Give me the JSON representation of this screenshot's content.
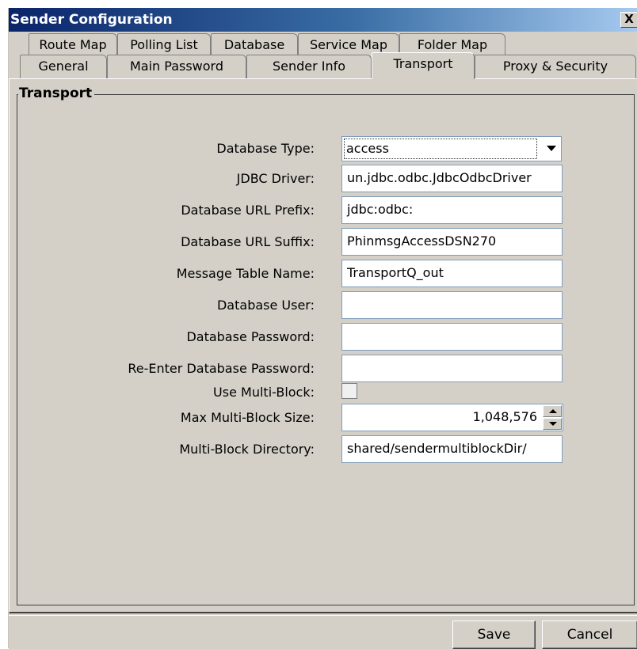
{
  "window": {
    "title": "Sender Configuration",
    "close_label": "X"
  },
  "tabs": {
    "row1": [
      "Route Map",
      "Polling List",
      "Database",
      "Service Map",
      "Folder Map"
    ],
    "row2": [
      "General",
      "Main Password",
      "Sender Info",
      "Transport",
      "Proxy & Security"
    ],
    "active": "Transport"
  },
  "group": {
    "title": "Transport"
  },
  "fields": {
    "database_type": {
      "label": "Database Type:",
      "value": "access"
    },
    "jdbc_driver": {
      "label": "JDBC Driver:",
      "value": "un.jdbc.odbc.JdbcOdbcDriver"
    },
    "db_url_prefix": {
      "label": "Database URL Prefix:",
      "value": "jdbc:odbc:"
    },
    "db_url_suffix": {
      "label": "Database URL Suffix:",
      "value": "PhinmsgAccessDSN270"
    },
    "message_table": {
      "label": "Message Table Name:",
      "value": "TransportQ_out"
    },
    "db_user": {
      "label": "Database User:",
      "value": ""
    },
    "db_password": {
      "label": "Database Password:",
      "value": ""
    },
    "db_password_confirm": {
      "label": "Re-Enter Database Password:",
      "value": ""
    },
    "use_multiblock": {
      "label": "Use Multi-Block:",
      "checked": false
    },
    "max_multiblock_size": {
      "label": "Max Multi-Block Size:",
      "value": "1,048,576"
    },
    "multiblock_dir": {
      "label": "Multi-Block Directory:",
      "value": "shared/sendermultiblockDir/"
    }
  },
  "buttons": {
    "save": "Save",
    "cancel": "Cancel"
  }
}
